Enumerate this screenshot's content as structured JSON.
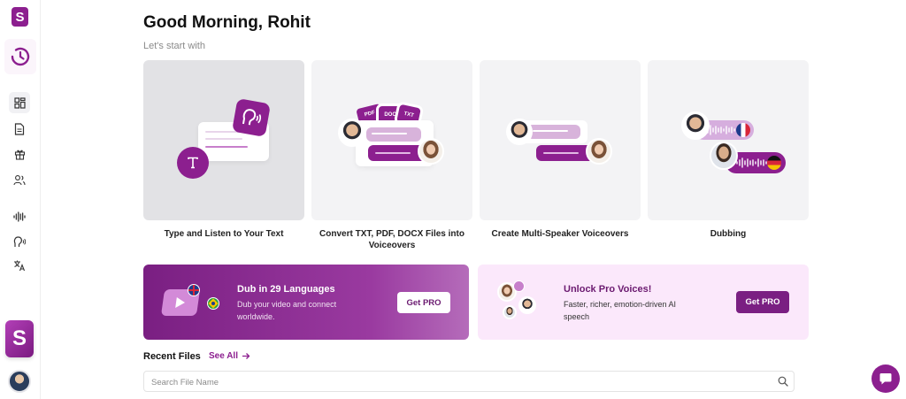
{
  "sidebar": {
    "logo_letter": "S",
    "brand_letter": "S",
    "icons": [
      "history-icon",
      "dashboard-icon",
      "document-icon",
      "gift-icon",
      "users-icon",
      "waveform-icon",
      "voice-icon",
      "translate-icon"
    ]
  },
  "header": {
    "greeting": "Good Morning, Rohit",
    "subtitle": "Let's start with"
  },
  "cards": [
    {
      "label": "Type and Listen to Your Text"
    },
    {
      "label": "Convert TXT, PDF, DOCX Files into Voiceovers",
      "badges": [
        "PDF",
        "DOC",
        "TXT"
      ]
    },
    {
      "label": "Create Multi-Speaker Voiceovers"
    },
    {
      "label": "Dubbing"
    }
  ],
  "promos": {
    "dub": {
      "title": "Dub in 29 Languages",
      "text": "Dub your video and connect worldwide.",
      "button": "Get PRO"
    },
    "voices": {
      "title": "Unlock Pro Voices!",
      "text": "Faster, richer, emotion-driven AI speech",
      "button": "Get PRO"
    }
  },
  "recent": {
    "title": "Recent Files",
    "see_all": "See All",
    "search_placeholder": "Search File Name"
  },
  "colors": {
    "brand": "#8c1f8f",
    "promo_light": "#fbe8fb",
    "card_bg": "#f3f3f5"
  }
}
